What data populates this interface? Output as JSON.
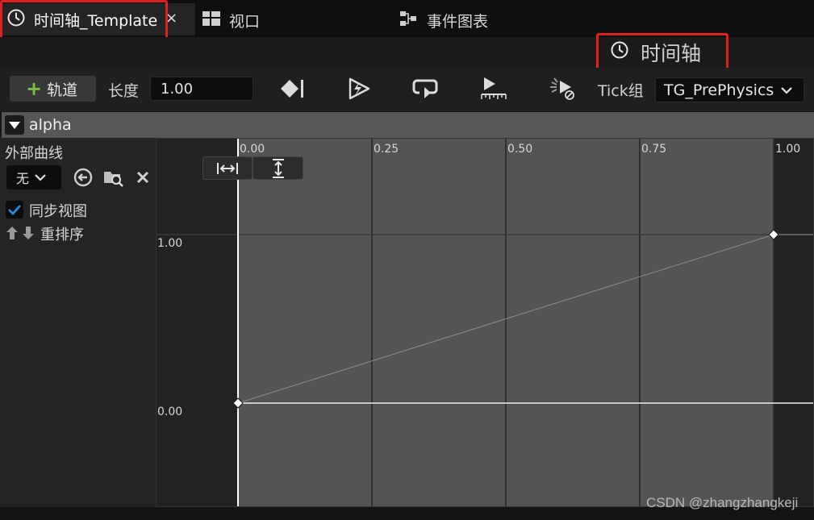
{
  "tabs": {
    "timeline": {
      "label": "时间轴_Template",
      "icon": "clock-icon",
      "close": "×"
    },
    "viewport": {
      "label": "视口",
      "icon": "viewport-grid-icon"
    },
    "event_graph": {
      "label": "事件图表",
      "icon": "node-graph-icon"
    }
  },
  "panel_title": "时间轴",
  "toolbar": {
    "add_track": {
      "plus": "+",
      "label": "轨道"
    },
    "length_label": "长度",
    "length_value": "1.00",
    "tick_group_label": "Tick组",
    "tick_group_value": "TG_PrePhysics",
    "icons": [
      "use-last-keyframe-icon",
      "autoplay-icon",
      "loop-icon",
      "replicated-icon",
      "ignore-time-dilation-icon"
    ]
  },
  "track": {
    "name": "alpha",
    "external_curve_label": "外部曲线",
    "curve_select_value": "无",
    "sync_view_label": "同步视图",
    "sync_view_checked": true,
    "reorder_label": "重排序"
  },
  "graph": {
    "x_ticks": [
      "0.00",
      "0.25",
      "0.50",
      "0.75",
      "1.00"
    ],
    "y_ticks": [
      "1.00",
      "0.00"
    ],
    "keys": [
      {
        "time": 0.0,
        "value": 0.0
      },
      {
        "time": 1.0,
        "value": 1.0
      }
    ]
  },
  "watermark": "CSDN @zhangzhangkeji",
  "colors": {
    "accent_green": "#7bc243",
    "highlight_red": "#e0201c",
    "checkbox_blue": "#2b8fe0"
  }
}
